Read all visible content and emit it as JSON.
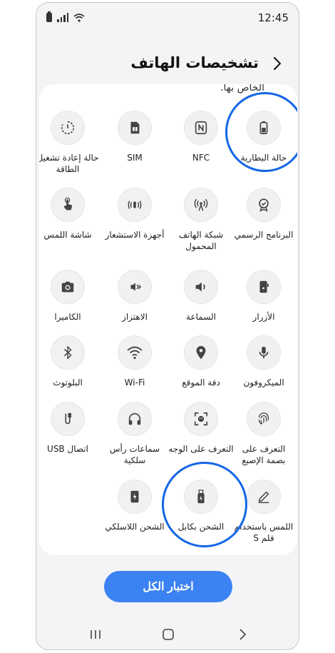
{
  "status_bar": {
    "time": "12:45"
  },
  "header": {
    "title": "تشخيصات الهاتف"
  },
  "cut_text": "الخاص بها.",
  "tiles": [
    {
      "label": "حالة البطارية",
      "icon": "battery-icon"
    },
    {
      "label": "NFC",
      "icon": "nfc-icon"
    },
    {
      "label": "SIM",
      "icon": "sim-card-icon"
    },
    {
      "label": "حالة إعادة تشغيل\nالطاقة",
      "icon": "power-restart-icon"
    },
    {
      "label": "البرنامج الرسمي",
      "icon": "official-software-badge-icon"
    },
    {
      "label": "شبكة الهاتف\nالمحمول",
      "icon": "mobile-network-icon"
    },
    {
      "label": "أجهزة الاستشعار",
      "icon": "sensors-icon"
    },
    {
      "label": "شاشة اللمس",
      "icon": "touch-screen-icon"
    },
    {
      "label": "الأزرار",
      "icon": "buttons-icon"
    },
    {
      "label": "السماعة",
      "icon": "speaker-icon"
    },
    {
      "label": "الاهتزاز",
      "icon": "vibration-icon"
    },
    {
      "label": "الكاميرا",
      "icon": "camera-icon"
    },
    {
      "label": "الميكروفون",
      "icon": "microphone-icon"
    },
    {
      "label": "دقة الموقع",
      "icon": "location-icon"
    },
    {
      "label": "Wi-Fi",
      "icon": "wifi-icon"
    },
    {
      "label": "البلوتوث",
      "icon": "bluetooth-icon"
    },
    {
      "label": "التعرف على\nبصمة الإصبع",
      "icon": "fingerprint-icon"
    },
    {
      "label": "التعرف على الوجه",
      "icon": "face-recognition-icon"
    },
    {
      "label": "سماعات رأس\nسلكية",
      "icon": "headphones-icon"
    },
    {
      "label": "اتصال USB",
      "icon": "usb-icon"
    },
    {
      "label": "اللمس باستخدام\nقلم S",
      "icon": "s-pen-icon"
    },
    {
      "label": "الشحن بكابل",
      "icon": "cable-charging-icon"
    },
    {
      "label": "الشحن اللاسلكي",
      "icon": "wireless-charging-icon"
    }
  ],
  "test_all_button": "اختبار الكل",
  "colors": {
    "accent": "#3b82f3",
    "highlight": "#1466e6",
    "background": "#f4f4f6",
    "card": "#ffffff"
  }
}
